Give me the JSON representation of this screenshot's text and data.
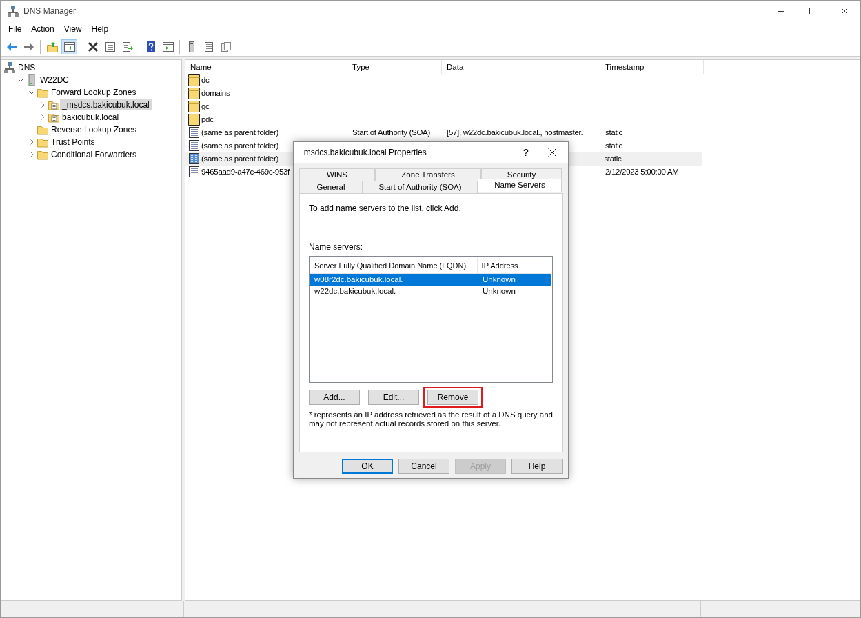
{
  "window": {
    "title": "DNS Manager"
  },
  "menu": [
    "File",
    "Action",
    "View",
    "Help"
  ],
  "toolbar": [
    {
      "pressed": false
    },
    {
      "pressed": false
    },
    {
      "pressed": false
    },
    {
      "pressed": true
    },
    {
      "pressed": false
    },
    {
      "pressed": false
    },
    {
      "pressed": false
    },
    {
      "pressed": false
    },
    {
      "pressed": false
    },
    {
      "pressed": false
    },
    {
      "pressed": false
    },
    {
      "pressed": false
    }
  ],
  "tree": [
    {
      "label": "DNS",
      "kind": "dns",
      "selected": false,
      "children": [
        {
          "label": "W22DC",
          "kind": "server",
          "expanded": true,
          "selected": false,
          "children": [
            {
              "label": "Forward Lookup Zones",
              "kind": "folder",
              "expanded": true,
              "selected": false,
              "children": [
                {
                  "label": "_msdcs.bakicubuk.local",
                  "kind": "zone",
                  "expanded": false,
                  "selected": true
                },
                {
                  "label": "bakicubuk.local",
                  "kind": "zone",
                  "expanded": false,
                  "selected": false
                }
              ]
            },
            {
              "label": "Reverse Lookup Zones",
              "kind": "folder",
              "selected": false
            },
            {
              "label": "Trust Points",
              "kind": "folder",
              "expanded": false,
              "selected": false
            },
            {
              "label": "Conditional Forwarders",
              "kind": "folder",
              "expanded": false,
              "selected": false
            }
          ]
        }
      ]
    }
  ],
  "table": {
    "columns": [
      "Name",
      "Type",
      "Data",
      "Timestamp"
    ],
    "rows": [
      {
        "kind": "folder",
        "name": "dc",
        "selected": false
      },
      {
        "kind": "folder",
        "name": "domains",
        "selected": false
      },
      {
        "kind": "folder",
        "name": "gc",
        "selected": false
      },
      {
        "kind": "folder",
        "name": "pdc",
        "selected": false
      },
      {
        "kind": "record",
        "name": "(same as parent folder)",
        "type": "Start of Authority (SOA)",
        "data": "[57], w22dc.bakicubuk.local., hostmaster.",
        "timestamp": "static",
        "selected": false
      },
      {
        "kind": "record",
        "name": "(same as parent folder)",
        "timestamp": "static",
        "selected": false
      },
      {
        "kind": "record",
        "name": "(same as parent folder)",
        "timestamp": "static",
        "selected": true
      },
      {
        "kind": "record",
        "name": "9465aad9-a47c-469c-953f",
        "timestamp": "2/12/2023 5:00:00 AM",
        "selected": false
      }
    ]
  },
  "dialog": {
    "title": "_msdcs.bakicubuk.local Properties",
    "help": "?",
    "tab_rows": [
      [
        {
          "label": "WINS",
          "selected": false
        },
        {
          "label": "Zone Transfers",
          "selected": false
        },
        {
          "label": "Security",
          "selected": false
        }
      ],
      [
        {
          "label": "General",
          "selected": false
        },
        {
          "label": "Start of Authority (SOA)",
          "selected": false
        },
        {
          "label": "Name Servers",
          "selected": true
        }
      ]
    ],
    "intro": "To add name servers to the list, click Add.",
    "list_label": "Name servers:",
    "list_columns": [
      "Server Fully Qualified Domain Name (FQDN)",
      "IP Address"
    ],
    "servers": [
      {
        "fqdn": "w08r2dc.bakicubuk.local.",
        "ip": "Unknown",
        "selected": true
      },
      {
        "fqdn": "w22dc.bakicubuk.local.",
        "ip": "Unknown",
        "selected": false
      }
    ],
    "list_buttons": [
      {
        "label": "Add...",
        "highlighted": false
      },
      {
        "label": "Edit...",
        "highlighted": false
      },
      {
        "label": "Remove",
        "highlighted": true
      }
    ],
    "note": "* represents an IP address retrieved as the result of a DNS query and may not represent actual records stored on this server.",
    "footer_buttons": [
      {
        "label": "OK",
        "default": true,
        "disabled": false
      },
      {
        "label": "Cancel",
        "default": false,
        "disabled": false
      },
      {
        "label": "Apply",
        "default": false,
        "disabled": true
      },
      {
        "label": "Help",
        "default": false,
        "disabled": false
      }
    ]
  }
}
